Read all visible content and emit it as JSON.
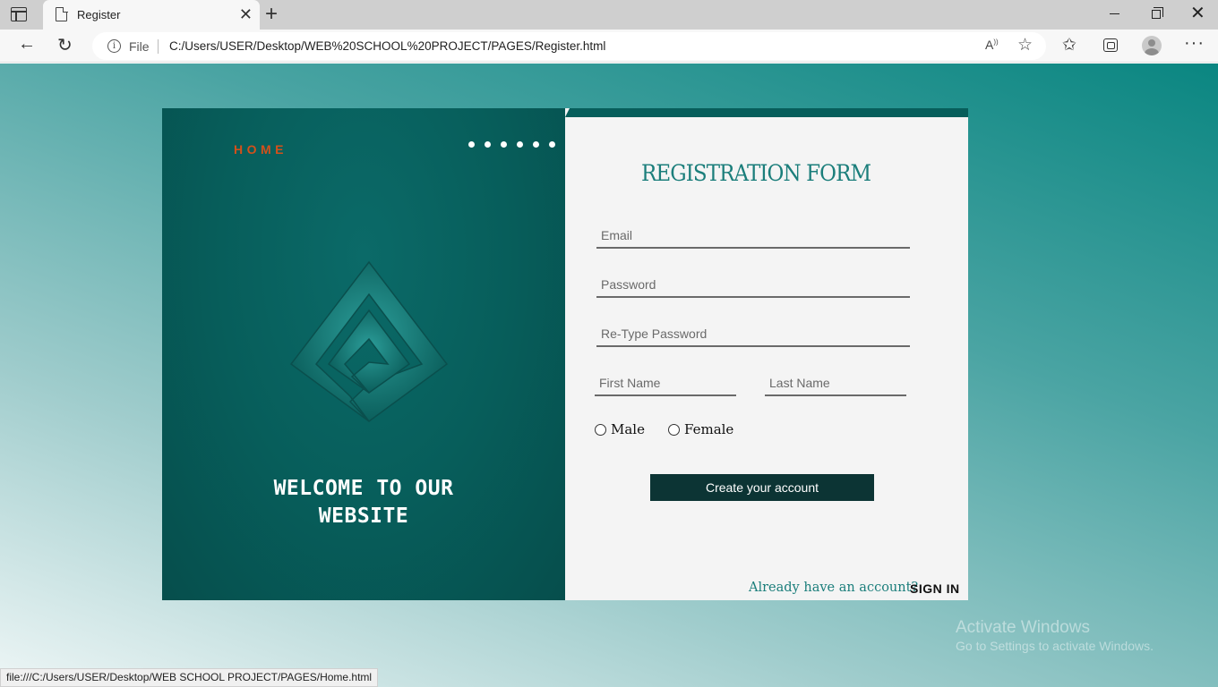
{
  "browser": {
    "tab_title": "Register",
    "address": {
      "scheme_label": "File",
      "url": "C:/Users/USER/Desktop/WEB%20SCHOOL%20PROJECT/PAGES/Register.html"
    },
    "status_url": "file:///C:/Users/USER/Desktop/WEB SCHOOL PROJECT/PAGES/Home.html"
  },
  "left_panel": {
    "home_label": "HOME",
    "welcome_line1": "WELCOME TO OUR",
    "welcome_line2": "WEBSITE"
  },
  "form": {
    "title": "REGISTRATION FORM",
    "email_placeholder": "Email",
    "password_placeholder": "Password",
    "retype_placeholder": "Re-Type Password",
    "first_name_placeholder": "First Name",
    "last_name_placeholder": "Last Name",
    "gender_options": [
      "Male",
      "Female"
    ],
    "submit_label": "Create your account",
    "already_text": "Already have an account?",
    "sign_in_label": "SIGN IN"
  },
  "watermark": {
    "line1": "Activate Windows",
    "line2": "Go to Settings to activate Windows."
  },
  "colors": {
    "panel_dark": "#075e5b",
    "accent_teal": "#1b7e7b",
    "home_orange": "#d4501a",
    "button_dark": "#0c3434"
  }
}
